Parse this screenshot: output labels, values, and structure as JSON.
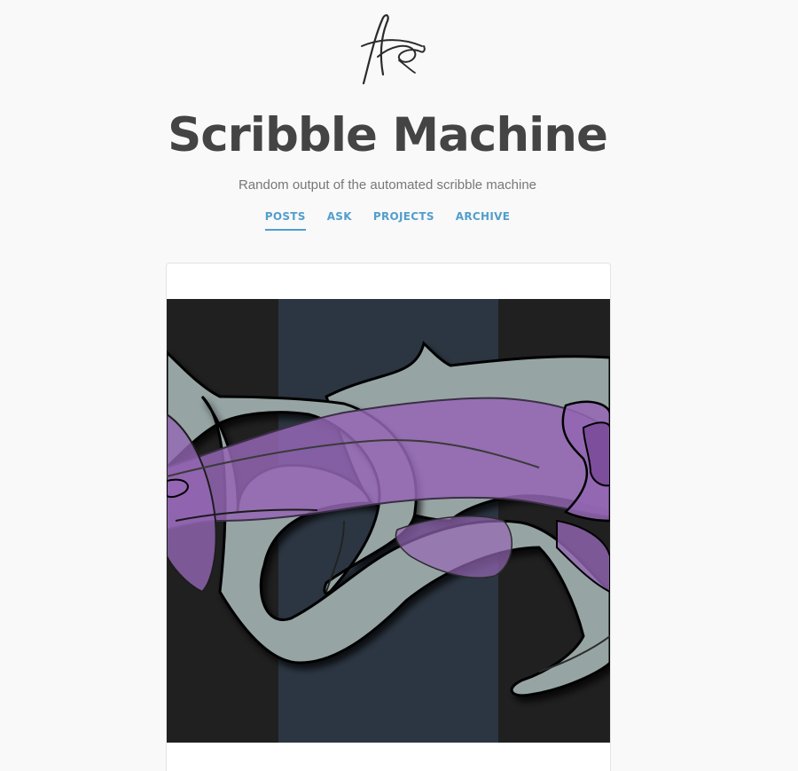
{
  "site": {
    "title": "Scribble Machine",
    "description": "Random output of the automated scribble machine"
  },
  "nav": {
    "items": [
      {
        "label": "POSTS",
        "active": true
      },
      {
        "label": "ASK",
        "active": false
      },
      {
        "label": "PROJECTS",
        "active": false
      },
      {
        "label": "ARCHIVE",
        "active": false
      }
    ]
  },
  "colors": {
    "background": "#f9f9fa",
    "title": "#444444",
    "description": "#777777",
    "link_accent": "#529ecc",
    "art_dark": "#202020",
    "art_navy": "#2c3642",
    "art_gray": "#97a4a4",
    "art_purple": "#9466b4"
  },
  "post": {
    "image": "scribble-artwork"
  }
}
